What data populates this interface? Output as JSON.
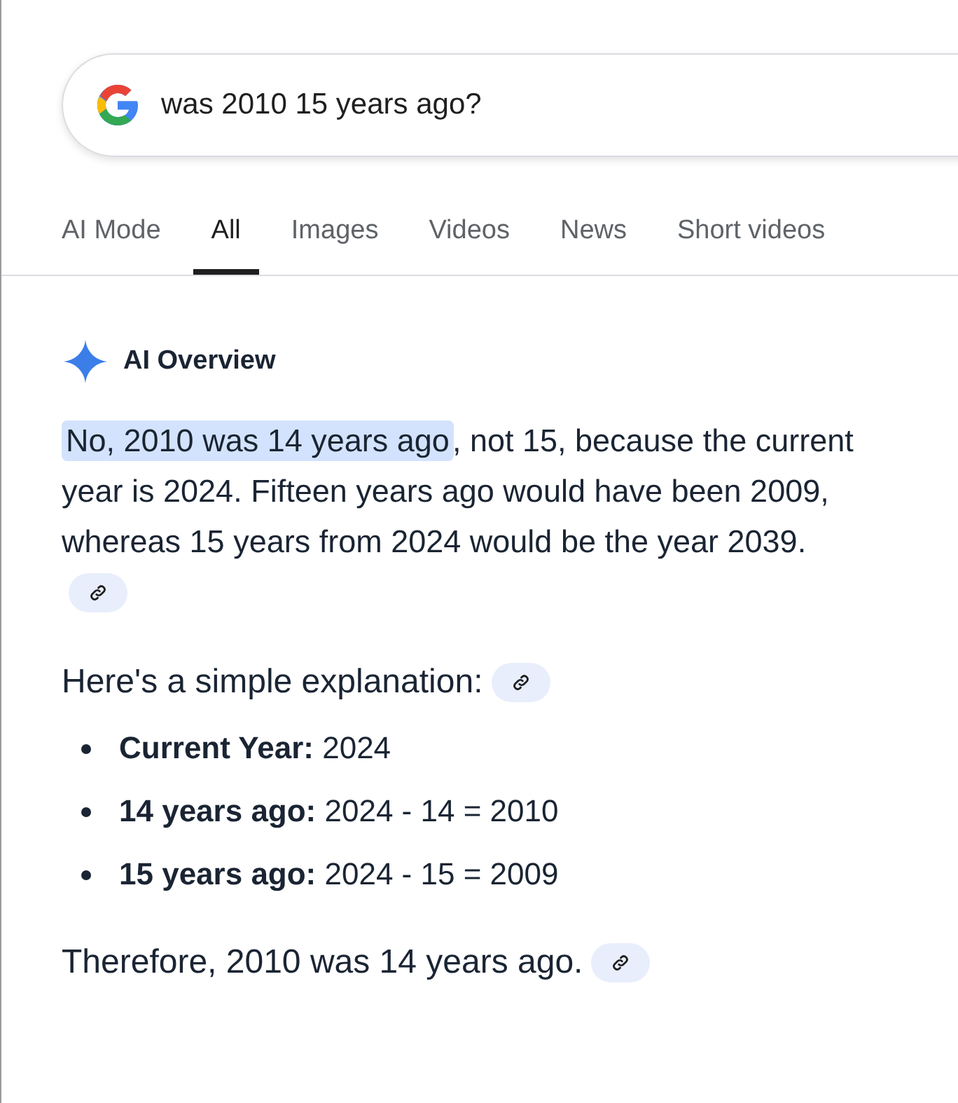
{
  "search": {
    "query": "was 2010 15 years ago?"
  },
  "tabs": [
    {
      "label": "AI Mode",
      "selected": false
    },
    {
      "label": "All",
      "selected": true
    },
    {
      "label": "Images",
      "selected": false
    },
    {
      "label": "Videos",
      "selected": false
    },
    {
      "label": "News",
      "selected": false
    },
    {
      "label": "Short videos",
      "selected": false
    }
  ],
  "overview": {
    "title": "AI Overview",
    "answer": {
      "highlight": "No, 2010 was 14 years ago",
      "rest": ", not 15, because the current year is 2024. Fifteen years ago would have been 2009, whereas 15 years from 2024 would be the year 2039.",
      "link_chip": true
    },
    "explanation_heading": {
      "text": "Here's a simple explanation:",
      "link_chip": true
    },
    "bullets": [
      "**Current Year:** 2024",
      "**14 years ago:** 2024 - 14 = 2010",
      "**15 years ago:** 2024 - 15 = 2009"
    ],
    "conclusion": {
      "text": "Therefore, 2010 was 14 years ago.",
      "link_chip": true
    }
  }
}
